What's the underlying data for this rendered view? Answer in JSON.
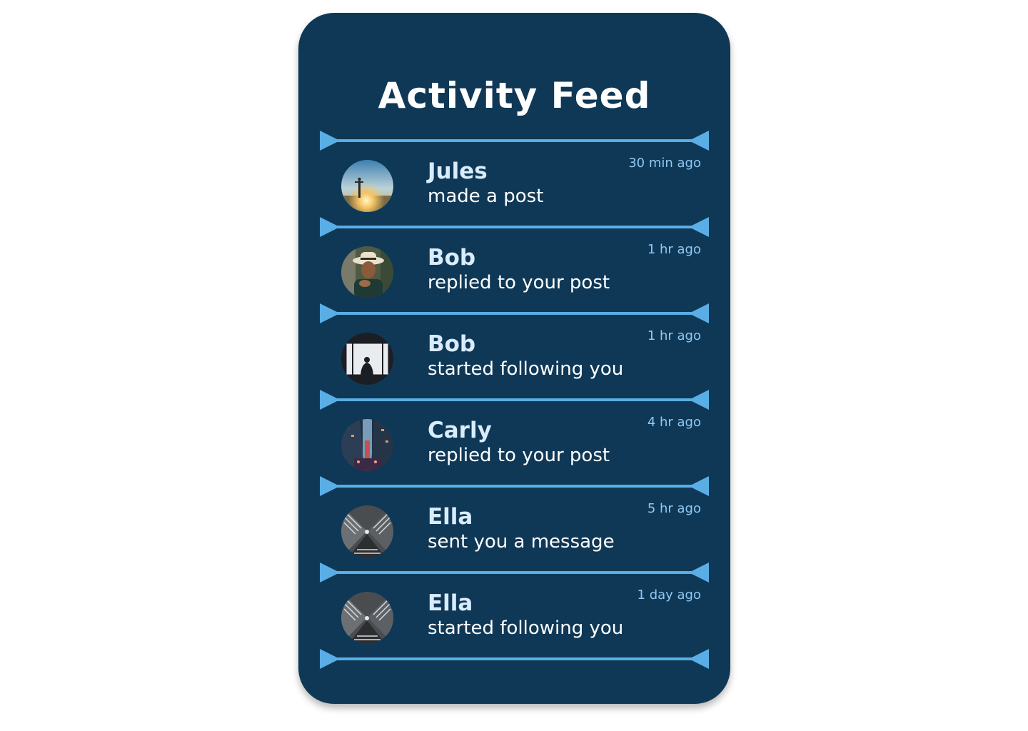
{
  "feed": {
    "title": "Activity Feed",
    "colors": {
      "card_background": "#0f3857",
      "divider": "#5aaee6",
      "name_text": "#d9ecfb",
      "time_text": "#8fc8f2"
    },
    "items": [
      {
        "name": "Jules",
        "action": "made a post",
        "time": "30 min ago",
        "avatar": "person-sunset-photo"
      },
      {
        "name": "Bob",
        "action": "replied to your post",
        "time": "1 hr ago",
        "avatar": "man-with-hat-photo"
      },
      {
        "name": "Bob",
        "action": "started following you",
        "time": "1 hr ago",
        "avatar": "silhouette-window-photo"
      },
      {
        "name": "Carly",
        "action": "replied to your post",
        "time": "4 hr ago",
        "avatar": "city-street-photo"
      },
      {
        "name": "Ella",
        "action": "sent you a message",
        "time": "5 hr ago",
        "avatar": "escalator-photo"
      },
      {
        "name": "Ella",
        "action": "started following you",
        "time": "1 day ago",
        "avatar": "escalator-photo"
      }
    ]
  }
}
